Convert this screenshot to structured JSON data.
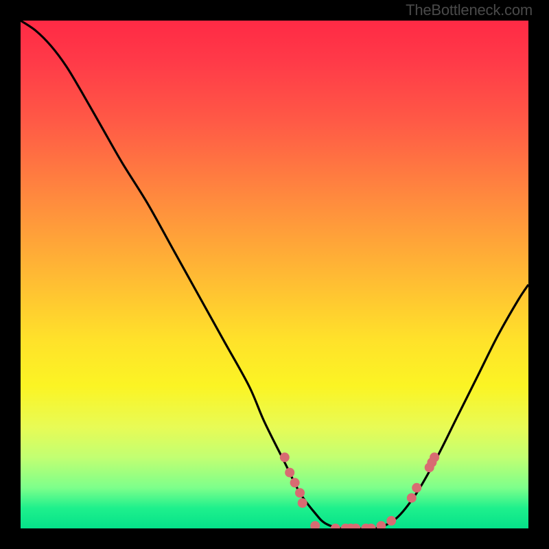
{
  "watermark": "TheBottleneck.com",
  "chart_data": {
    "type": "line",
    "title": "",
    "xlabel": "",
    "ylabel": "",
    "xlim": [
      0,
      100
    ],
    "ylim": [
      0,
      100
    ],
    "series": [
      {
        "name": "curve",
        "x": [
          0,
          3,
          6,
          9,
          12,
          16,
          20,
          25,
          30,
          35,
          40,
          45,
          48,
          52,
          55,
          58,
          60,
          63,
          66,
          70,
          74,
          78,
          82,
          86,
          90,
          94,
          98,
          100
        ],
        "y": [
          100,
          98,
          95,
          91,
          86,
          79,
          72,
          64,
          55,
          46,
          37,
          28,
          21,
          13,
          7,
          3,
          1,
          0,
          0,
          0,
          2,
          7,
          14,
          22,
          30,
          38,
          45,
          48
        ]
      }
    ],
    "dots": [
      {
        "x": 52,
        "y": 14
      },
      {
        "x": 53,
        "y": 11
      },
      {
        "x": 54,
        "y": 9
      },
      {
        "x": 55,
        "y": 7
      },
      {
        "x": 55.5,
        "y": 5
      },
      {
        "x": 58,
        "y": 0.5
      },
      {
        "x": 62,
        "y": 0
      },
      {
        "x": 64,
        "y": 0
      },
      {
        "x": 65,
        "y": 0
      },
      {
        "x": 66,
        "y": 0
      },
      {
        "x": 68,
        "y": 0
      },
      {
        "x": 69,
        "y": 0
      },
      {
        "x": 71,
        "y": 0.5
      },
      {
        "x": 73,
        "y": 1.5
      },
      {
        "x": 77,
        "y": 6
      },
      {
        "x": 78,
        "y": 8
      },
      {
        "x": 80.5,
        "y": 12
      },
      {
        "x": 81,
        "y": 13
      },
      {
        "x": 81.5,
        "y": 14
      }
    ],
    "dot_color": "#d86b72",
    "curve_color": "#000000"
  }
}
